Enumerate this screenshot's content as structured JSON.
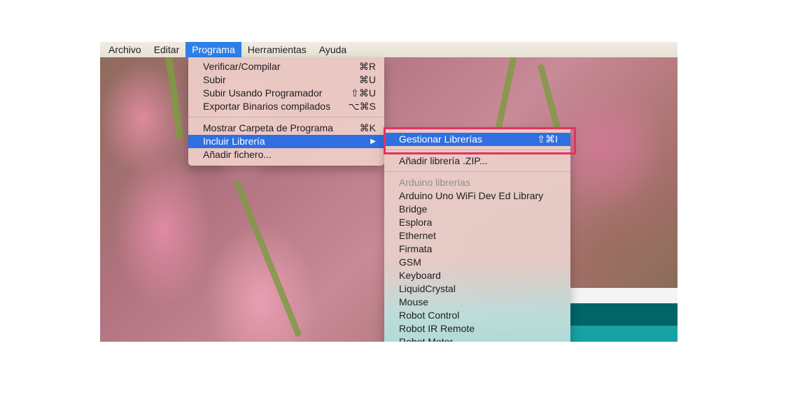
{
  "menubar": {
    "items": [
      "Archivo",
      "Editar",
      "Programa",
      "Herramientas",
      "Ayuda"
    ],
    "active": "Programa"
  },
  "programa_menu": {
    "verificar": {
      "label": "Verificar/Compilar",
      "shortcut": "⌘R"
    },
    "subir": {
      "label": "Subir",
      "shortcut": "⌘U"
    },
    "subir_programador": {
      "label": "Subir Usando Programador",
      "shortcut": "⇧⌘U"
    },
    "exportar": {
      "label": "Exportar Binarios compilados",
      "shortcut": "⌥⌘S"
    },
    "mostrar_carpeta": {
      "label": "Mostrar Carpeta de Programa",
      "shortcut": "⌘K"
    },
    "incluir_libreria": {
      "label": "Incluir Librería",
      "arrow": "▶"
    },
    "anadir_fichero": {
      "label": "Añadir fichero..."
    }
  },
  "libreria_submenu": {
    "gestionar": {
      "label": "Gestionar Librerías",
      "shortcut": "⇧⌘I"
    },
    "anadir_zip": {
      "label": "Añadir librería .ZIP..."
    },
    "header": "Arduino librerías",
    "libraries": [
      "Arduino Uno WiFi Dev Ed Library",
      "Bridge",
      "Esplora",
      "Ethernet",
      "Firmata",
      "GSM",
      "Keyboard",
      "LiquidCrystal",
      "Mouse",
      "Robot Control",
      "Robot IR Remote",
      "Robot Motor"
    ]
  },
  "colors": {
    "highlight": "#2f6fe0",
    "annotation": "#e8305f",
    "ide_teal": "#17a1a5"
  }
}
